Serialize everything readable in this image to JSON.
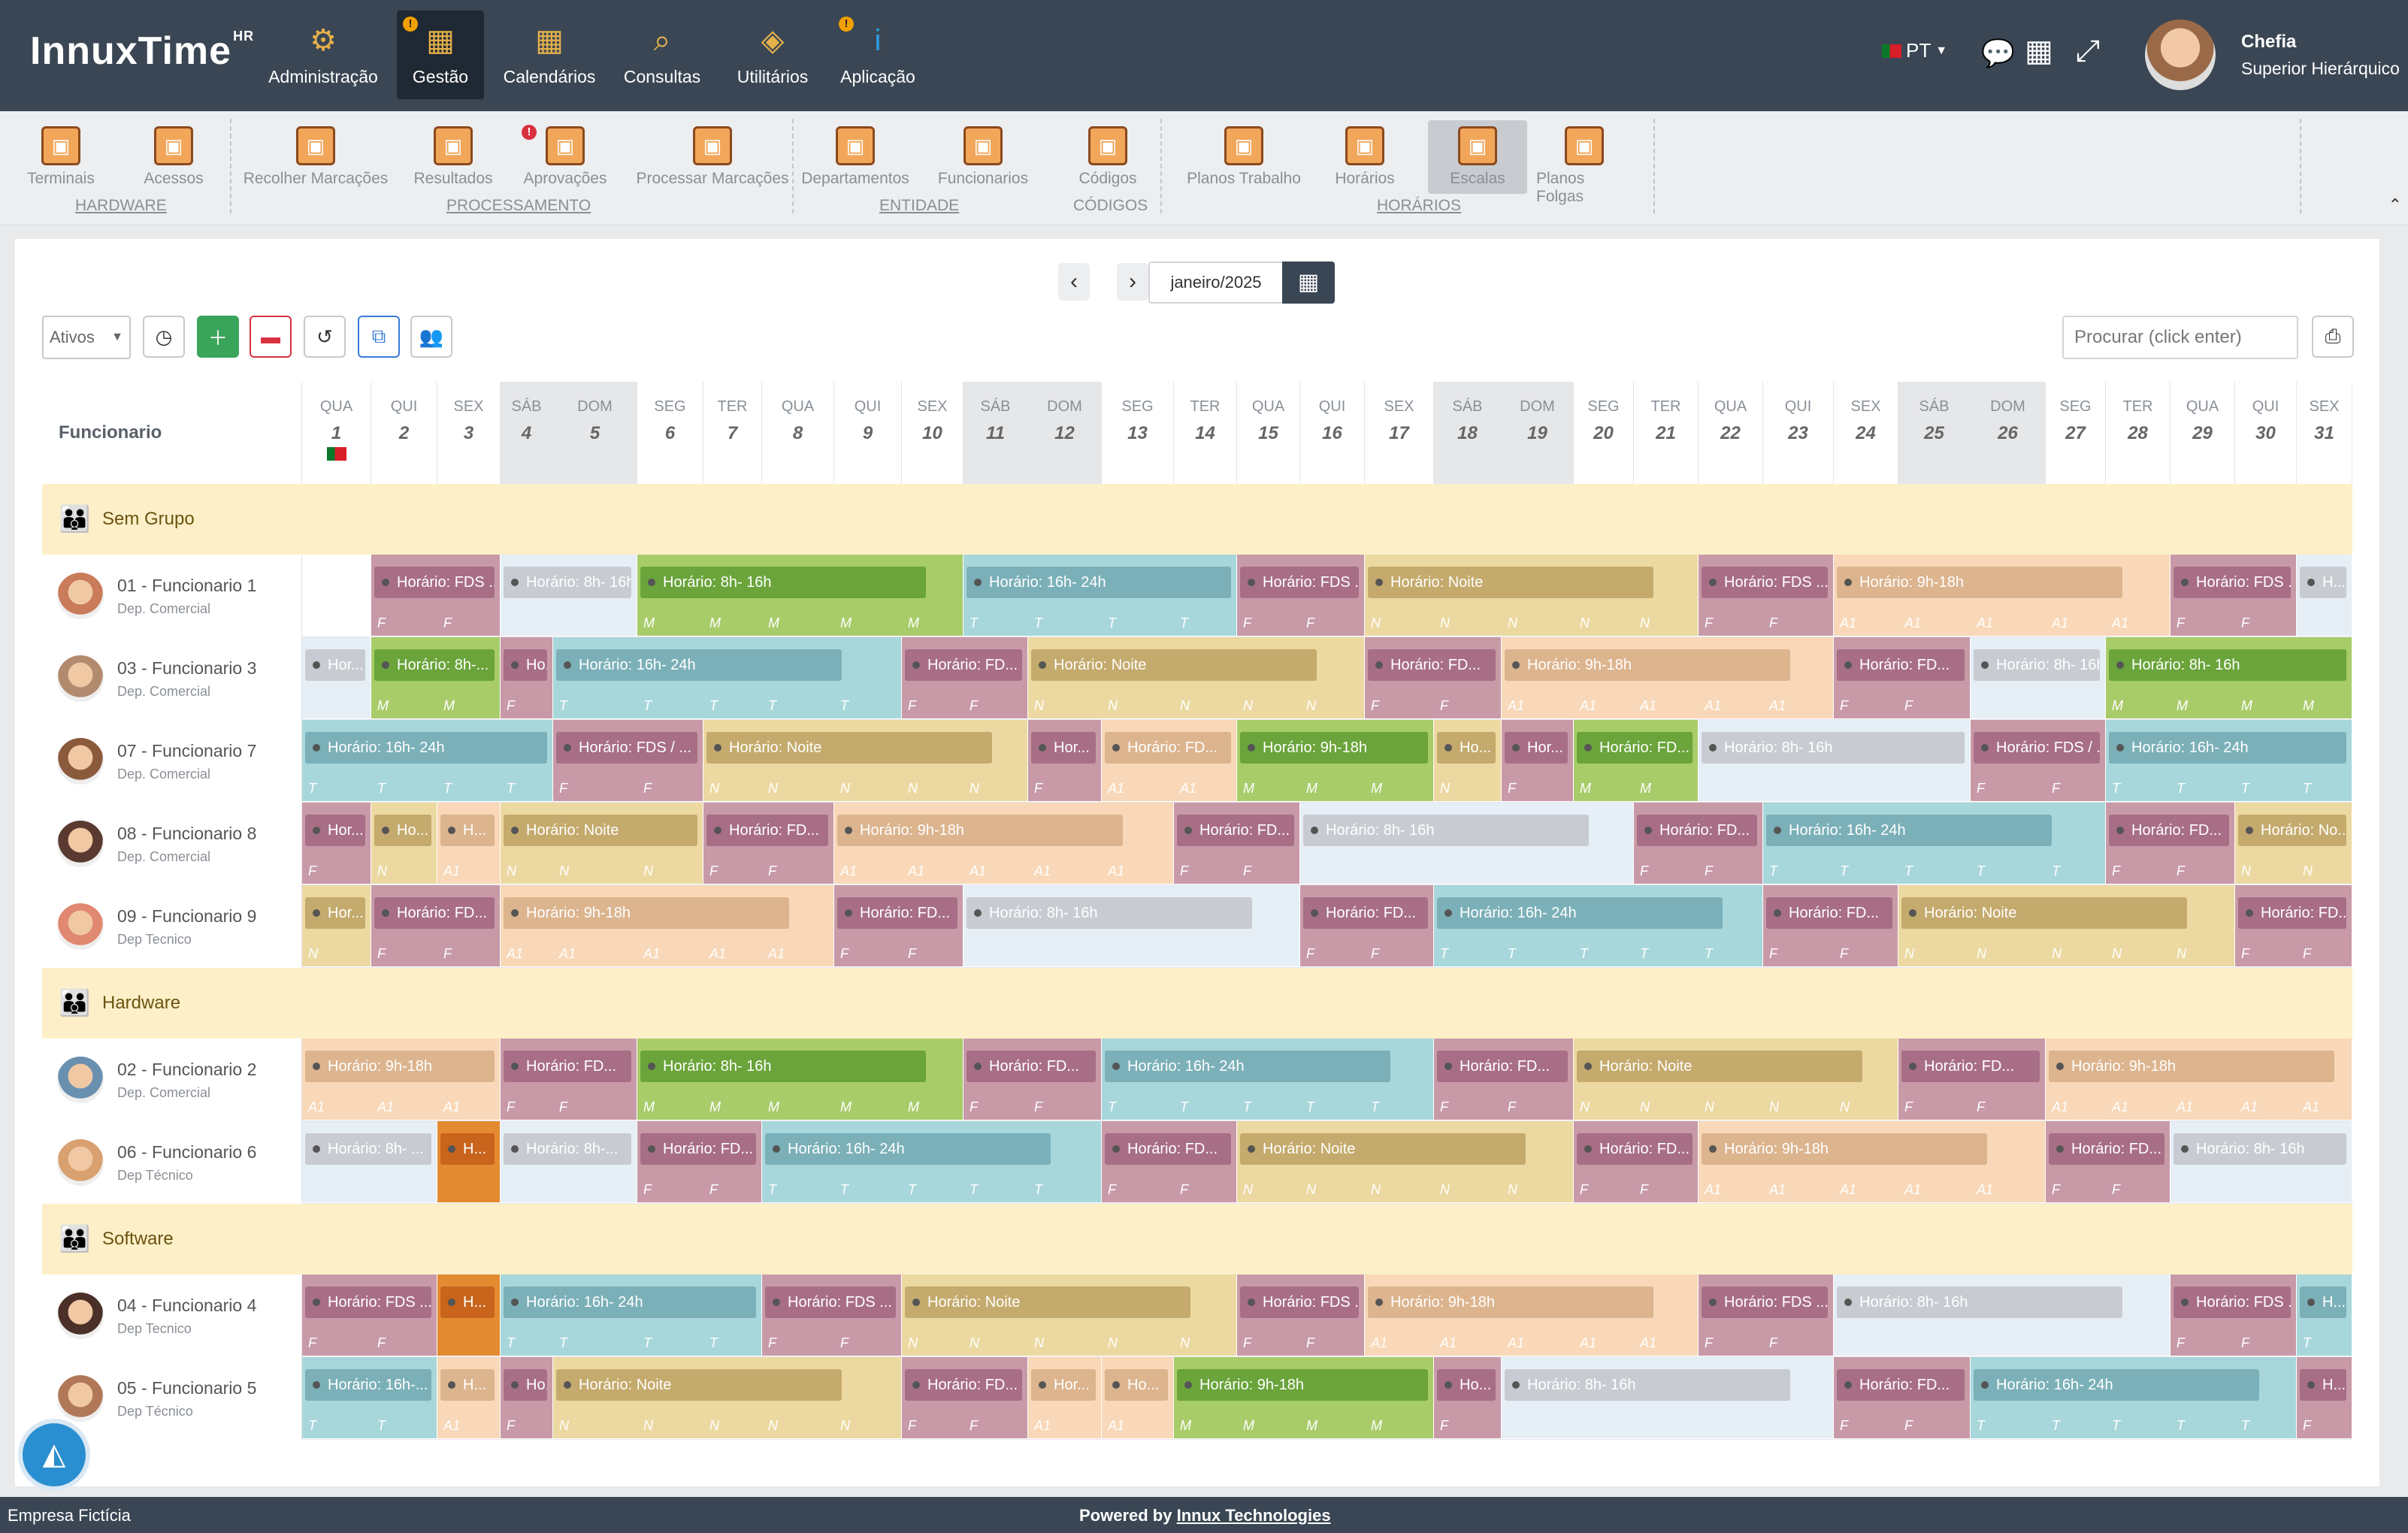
{
  "app": {
    "logo": "InnuxTime",
    "logo_sup": "HR"
  },
  "nav": [
    {
      "label": "Administração",
      "icon": "gear-icon"
    },
    {
      "label": "Gestão",
      "icon": "management-icon"
    },
    {
      "label": "Calendários",
      "icon": "calendar-icon"
    },
    {
      "label": "Consultas",
      "icon": "search-doc-icon"
    },
    {
      "label": "Utilitários",
      "icon": "tools-icon"
    },
    {
      "label": "Aplicação",
      "icon": "info-icon"
    }
  ],
  "user": {
    "lang": "PT",
    "name": "Chefia",
    "role": "Superior Hierárquico"
  },
  "subnav": [
    {
      "label": "Terminais"
    },
    {
      "label": "Acessos"
    },
    {
      "label": "Recolher Marcações"
    },
    {
      "label": "Resultados"
    },
    {
      "label": "Aprovações"
    },
    {
      "label": "Processar Marcações"
    },
    {
      "label": "Departamentos"
    },
    {
      "label": "Funcionarios"
    },
    {
      "label": "Códigos"
    },
    {
      "label": "Planos Trabalho"
    },
    {
      "label": "Horários"
    },
    {
      "label": "Escalas"
    },
    {
      "label": "Planos Folgas"
    }
  ],
  "groups_menu": [
    {
      "label": "HARDWARE"
    },
    {
      "label": "PROCESSAMENTO"
    },
    {
      "label": "ENTIDADE"
    },
    {
      "label": "CÓDIGOS"
    },
    {
      "label": "HORÁRIOS"
    }
  ],
  "toolbar": {
    "month": "janeiro/2025",
    "filter": "Ativos",
    "search_placeholder": "Procurar (click enter)"
  },
  "table": {
    "first_col": "Funcionario"
  },
  "days": [
    {
      "w": "QUA",
      "d": "1"
    },
    {
      "w": "QUI",
      "d": "2"
    },
    {
      "w": "SEX",
      "d": "3"
    },
    {
      "w": "SÁB",
      "d": "4"
    },
    {
      "w": "DOM",
      "d": "5"
    },
    {
      "w": "SEG",
      "d": "6"
    },
    {
      "w": "TER",
      "d": "7"
    },
    {
      "w": "QUA",
      "d": "8"
    },
    {
      "w": "QUI",
      "d": "9"
    },
    {
      "w": "SEX",
      "d": "10"
    },
    {
      "w": "SÁB",
      "d": "11"
    },
    {
      "w": "DOM",
      "d": "12"
    },
    {
      "w": "SEG",
      "d": "13"
    },
    {
      "w": "TER",
      "d": "14"
    },
    {
      "w": "QUA",
      "d": "15"
    },
    {
      "w": "QUI",
      "d": "16"
    },
    {
      "w": "SEX",
      "d": "17"
    },
    {
      "w": "SÁB",
      "d": "18"
    },
    {
      "w": "DOM",
      "d": "19"
    },
    {
      "w": "SEG",
      "d": "20"
    },
    {
      "w": "TER",
      "d": "21"
    },
    {
      "w": "QUA",
      "d": "22"
    },
    {
      "w": "QUI",
      "d": "23"
    },
    {
      "w": "SEX",
      "d": "24"
    },
    {
      "w": "SÁB",
      "d": "25"
    },
    {
      "w": "DOM",
      "d": "26"
    },
    {
      "w": "SEG",
      "d": "27"
    },
    {
      "w": "TER",
      "d": "28"
    },
    {
      "w": "QUA",
      "d": "29"
    },
    {
      "w": "QUI",
      "d": "30"
    },
    {
      "w": "SEX",
      "d": "31"
    }
  ],
  "legend_colors": {
    "F": "#c89aa8",
    "T": "#a8d7db",
    "N": "#ecd9a2",
    "A1": "#f8d8b8",
    "M": "#a8cc6a",
    "E": "#e6eef6",
    "H": "#e48a30"
  },
  "rows": [
    {
      "type": "group",
      "label": "Sem Grupo"
    },
    {
      "type": "emp",
      "name": "01 - Funcionario 1",
      "dep": "Dep. Comercial",
      "av": "#c97b5a",
      "segs": [
        [
          1,
          2,
          "F",
          "Horário: FDS ..."
        ],
        [
          3,
          4,
          "E",
          "Horário: 8h- 16h"
        ],
        [
          5,
          9,
          "M",
          "Horário: 8h- 16h"
        ],
        [
          10,
          13,
          "T",
          "Horário: 16h- 24h"
        ],
        [
          14,
          15,
          "F",
          "Horário: FDS ..."
        ],
        [
          16,
          20,
          "N",
          "Horário: Noite"
        ],
        [
          21,
          22,
          "F",
          "Horário: FDS ..."
        ],
        [
          23,
          27,
          "A1",
          "Horário: 9h-18h"
        ],
        [
          28,
          29,
          "F",
          "Horário: FDS ..."
        ],
        [
          30,
          30,
          "E",
          "H..."
        ]
      ]
    },
    {
      "type": "emp",
      "name": "03 - Funcionario 3",
      "dep": "Dep. Comercial",
      "av": "#b28a6e",
      "segs": [
        [
          0,
          0,
          "E",
          "Hor..."
        ],
        [
          1,
          2,
          "M",
          "Horário: 8h-..."
        ],
        [
          3,
          3,
          "F",
          "Ho..."
        ],
        [
          4,
          8,
          "T",
          "Horário: 16h- 24h"
        ],
        [
          9,
          10,
          "F",
          "Horário: FD..."
        ],
        [
          11,
          15,
          "N",
          "Horário: Noite"
        ],
        [
          16,
          17,
          "F",
          "Horário: FD..."
        ],
        [
          18,
          22,
          "A1",
          "Horário: 9h-18h"
        ],
        [
          23,
          24,
          "F",
          "Horário: FD..."
        ],
        [
          25,
          26,
          "E",
          "Horário: 8h- 16h"
        ],
        [
          27,
          30,
          "M",
          "Horário: 8h- 16h"
        ]
      ]
    },
    {
      "type": "emp",
      "name": "07 - Funcionario 7",
      "dep": "Dep. Comercial",
      "av": "#8b5a3c",
      "segs": [
        [
          0,
          3,
          "T",
          "Horário: 16h- 24h"
        ],
        [
          4,
          5,
          "F",
          "Horário: FDS / ..."
        ],
        [
          6,
          10,
          "N",
          "Horário: Noite"
        ],
        [
          11,
          11,
          "F",
          "Hor..."
        ],
        [
          12,
          13,
          "A1",
          "Horário: FD..."
        ],
        [
          14,
          16,
          "M",
          "Horário: 9h-18h"
        ],
        [
          17,
          17,
          "N",
          "Ho..."
        ],
        [
          18,
          18,
          "F",
          "Hor..."
        ],
        [
          19,
          20,
          "M",
          "Horário: FD..."
        ],
        [
          21,
          24,
          "E",
          "Horário: 8h- 16h"
        ],
        [
          25,
          26,
          "F",
          "Horário: FDS / ..."
        ],
        [
          27,
          30,
          "T",
          "Horário: 16h- 24h"
        ]
      ]
    },
    {
      "type": "emp",
      "name": "08 - Funcionario 8",
      "dep": "Dep. Comercial",
      "av": "#5a3a30",
      "segs": [
        [
          0,
          0,
          "F",
          "Hor..."
        ],
        [
          1,
          1,
          "N",
          "Ho..."
        ],
        [
          2,
          2,
          "A1",
          "H..."
        ],
        [
          3,
          5,
          "N",
          "Horário: Noite"
        ],
        [
          6,
          7,
          "F",
          "Horário: FD..."
        ],
        [
          8,
          12,
          "A1",
          "Horário: 9h-18h"
        ],
        [
          13,
          14,
          "F",
          "Horário: FD..."
        ],
        [
          15,
          19,
          "E",
          "Horário: 8h- 16h"
        ],
        [
          20,
          21,
          "F",
          "Horário: FD..."
        ],
        [
          22,
          26,
          "T",
          "Horário: 16h- 24h"
        ],
        [
          27,
          28,
          "F",
          "Horário: FD..."
        ],
        [
          29,
          30,
          "N",
          "Horário: No..."
        ]
      ]
    },
    {
      "type": "emp",
      "name": "09 - Funcionario 9",
      "dep": "Dep Tecnico",
      "av": "#e08870",
      "segs": [
        [
          0,
          0,
          "N",
          "Hor..."
        ],
        [
          1,
          2,
          "F",
          "Horário: FD..."
        ],
        [
          3,
          7,
          "A1",
          "Horário: 9h-18h"
        ],
        [
          8,
          9,
          "F",
          "Horário: FD..."
        ],
        [
          10,
          14,
          "E",
          "Horário: 8h- 16h"
        ],
        [
          15,
          16,
          "F",
          "Horário: FD..."
        ],
        [
          17,
          21,
          "T",
          "Horário: 16h- 24h"
        ],
        [
          22,
          23,
          "F",
          "Horário: FD..."
        ],
        [
          24,
          28,
          "N",
          "Horário: Noite"
        ],
        [
          29,
          30,
          "F",
          "Horário: FD..."
        ]
      ]
    },
    {
      "type": "group",
      "label": "Hardware"
    },
    {
      "type": "emp",
      "name": "02 - Funcionario 2",
      "dep": "Dep. Comercial",
      "av": "#6a90b0",
      "segs": [
        [
          0,
          2,
          "A1",
          "Horário: 9h-18h"
        ],
        [
          3,
          4,
          "F",
          "Horário: FD..."
        ],
        [
          5,
          9,
          "M",
          "Horário: 8h- 16h"
        ],
        [
          10,
          11,
          "F",
          "Horário: FD..."
        ],
        [
          12,
          16,
          "T",
          "Horário: 16h- 24h"
        ],
        [
          17,
          18,
          "F",
          "Horário: FD..."
        ],
        [
          19,
          23,
          "N",
          "Horário: Noite"
        ],
        [
          24,
          25,
          "F",
          "Horário: FD..."
        ],
        [
          26,
          30,
          "A1",
          "Horário: 9h-18h"
        ]
      ]
    },
    {
      "type": "emp",
      "name": "06 - Funcionario 6",
      "dep": "Dep Técnico",
      "av": "#d9a070",
      "segs": [
        [
          0,
          1,
          "E",
          "Horário: 8h- ..."
        ],
        [
          2,
          2,
          "H",
          "H..."
        ],
        [
          3,
          4,
          "E",
          "Horário: 8h-..."
        ],
        [
          5,
          6,
          "F",
          "Horário: FD..."
        ],
        [
          7,
          11,
          "T",
          "Horário: 16h- 24h"
        ],
        [
          12,
          13,
          "F",
          "Horário: FD..."
        ],
        [
          14,
          18,
          "N",
          "Horário: Noite"
        ],
        [
          19,
          20,
          "F",
          "Horário: FD..."
        ],
        [
          21,
          25,
          "A1",
          "Horário: 9h-18h"
        ],
        [
          26,
          27,
          "F",
          "Horário: FD..."
        ],
        [
          28,
          30,
          "E",
          "Horário: 8h- 16h"
        ]
      ]
    },
    {
      "type": "group",
      "label": "Software"
    },
    {
      "type": "emp",
      "name": "04 - Funcionario 4",
      "dep": "Dep Tecnico",
      "av": "#4a3028",
      "segs": [
        [
          0,
          1,
          "F",
          "Horário: FDS ..."
        ],
        [
          2,
          2,
          "H",
          "H..."
        ],
        [
          3,
          6,
          "T",
          "Horário: 16h- 24h"
        ],
        [
          7,
          8,
          "F",
          "Horário: FDS ..."
        ],
        [
          9,
          13,
          "N",
          "Horário: Noite"
        ],
        [
          14,
          15,
          "F",
          "Horário: FDS ..."
        ],
        [
          16,
          20,
          "A1",
          "Horário: 9h-18h"
        ],
        [
          21,
          22,
          "F",
          "Horário: FDS ..."
        ],
        [
          23,
          27,
          "E",
          "Horário: 8h- 16h"
        ],
        [
          28,
          29,
          "F",
          "Horário: FDS ..."
        ],
        [
          30,
          30,
          "T",
          "H..."
        ]
      ]
    },
    {
      "type": "emp",
      "name": "05 - Funcionario 5",
      "dep": "Dep Técnico",
      "av": "#b07858",
      "segs": [
        [
          0,
          1,
          "T",
          "Horário: 16h-..."
        ],
        [
          2,
          2,
          "A1",
          "H..."
        ],
        [
          3,
          3,
          "F",
          "Ho..."
        ],
        [
          4,
          8,
          "N",
          "Horário: Noite"
        ],
        [
          9,
          10,
          "F",
          "Horário: FD..."
        ],
        [
          11,
          11,
          "A1",
          "Hor..."
        ],
        [
          12,
          12,
          "A1",
          "Ho..."
        ],
        [
          13,
          16,
          "M",
          "Horário: 9h-18h"
        ],
        [
          17,
          17,
          "F",
          "Ho..."
        ],
        [
          18,
          22,
          "E",
          "Horário: 8h- 16h"
        ],
        [
          23,
          24,
          "F",
          "Horário: FD..."
        ],
        [
          25,
          29,
          "T",
          "Horário: 16h- 24h"
        ],
        [
          30,
          30,
          "F",
          "H..."
        ]
      ]
    }
  ],
  "footer": {
    "company": "Empresa Fictícia",
    "powered": "Powered by",
    "brand": "Innux Technologies"
  }
}
